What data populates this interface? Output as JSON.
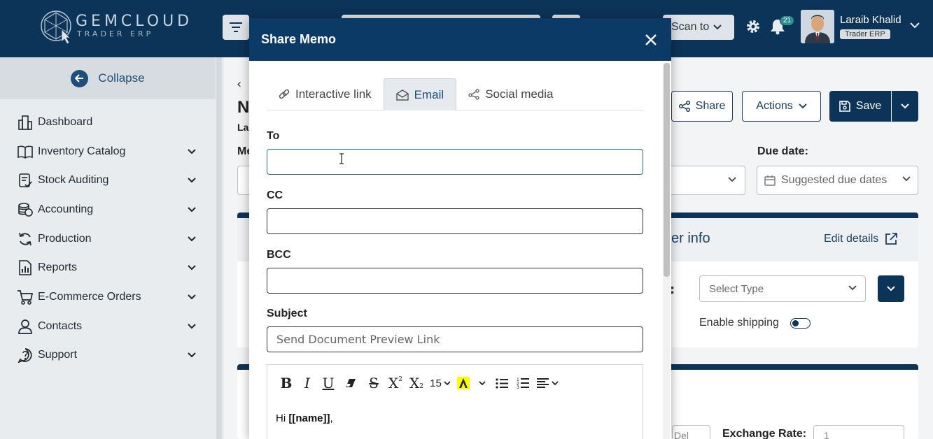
{
  "app": {
    "brand": "GEMCLOUD",
    "brand_sub": "TRADER ERP"
  },
  "topbar": {
    "scan_label": "Scan to",
    "notifications_count": "21",
    "user_name": "Laraib Khalid",
    "user_role": "Trader ERP"
  },
  "sidebar": {
    "collapse_label": "Collapse",
    "items": [
      {
        "label": "Dashboard",
        "icon": "building-icon",
        "expandable": false
      },
      {
        "label": "Inventory Catalog",
        "icon": "book-icon",
        "expandable": true
      },
      {
        "label": "Stock Auditing",
        "icon": "clipboard-check-icon",
        "expandable": true
      },
      {
        "label": "Accounting",
        "icon": "coins-icon",
        "expandable": true
      },
      {
        "label": "Production",
        "icon": "refresh-icon",
        "expandable": true
      },
      {
        "label": "Reports",
        "icon": "report-icon",
        "expandable": true
      },
      {
        "label": "E-Commerce Orders",
        "icon": "cart-icon",
        "expandable": true
      },
      {
        "label": "Contacts",
        "icon": "user-icon",
        "expandable": true
      },
      {
        "label": "Support",
        "icon": "help-icon",
        "expandable": true
      }
    ]
  },
  "page": {
    "title_partial": "N",
    "sub_partial": "La",
    "field_partial": "Me",
    "share_label": "Share",
    "actions_label": "Actions",
    "save_label": "Save",
    "due_date_label": "Due date:",
    "due_date_placeholder": "Suggested due dates",
    "info_title_partial": "er info",
    "edit_details_label": "Edit details",
    "type_placeholder": "Select Type",
    "enable_shipping_label": "Enable shipping",
    "bottom_select_partial": "Del",
    "exchange_rate_label": "Exchange Rate:",
    "exchange_rate_value": "1"
  },
  "modal": {
    "title": "Share Memo",
    "tabs": [
      {
        "label": "Interactive link",
        "icon": "link-icon",
        "active": false
      },
      {
        "label": "Email",
        "icon": "envelope-open-icon",
        "active": true
      },
      {
        "label": "Social media",
        "icon": "share-nodes-icon",
        "active": false
      }
    ],
    "to_label": "To",
    "to_value": "",
    "cc_label": "CC",
    "cc_value": "",
    "bcc_label": "BCC",
    "bcc_value": "",
    "subject_label": "Subject",
    "subject_placeholder": "Send Document Preview Link",
    "editor": {
      "font_size": "15",
      "greeting_prefix": "Hi ",
      "greeting_var": "[[name]]",
      "greeting_suffix": ","
    }
  }
}
